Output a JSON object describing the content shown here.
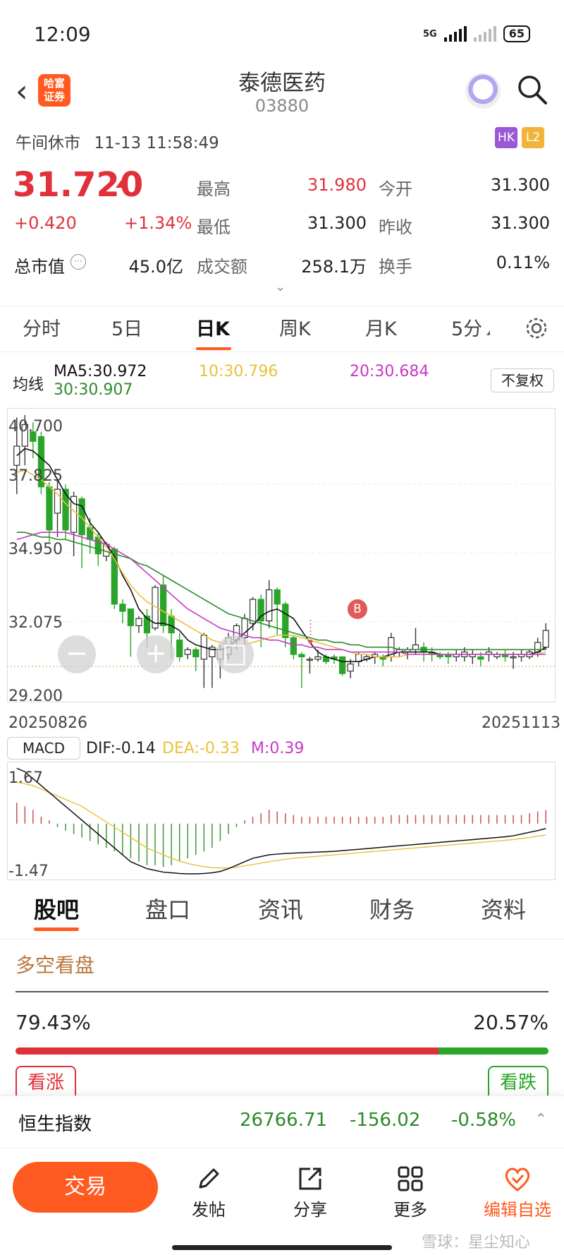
{
  "status": {
    "time": "12:09",
    "network": "5G",
    "battery": "65"
  },
  "header": {
    "logo_line1": "哈富",
    "logo_line2": "证券",
    "title": "泰德医药",
    "code": "03880"
  },
  "session": {
    "label": "午间休市",
    "datetime": "11-13 11:58:49",
    "badge_hk": "HK",
    "badge_l2": "L2"
  },
  "quote": {
    "price": "31.720",
    "change": "+0.420",
    "change_pct": "+1.34%",
    "high_label": "最高",
    "high": "31.980",
    "open_label": "今开",
    "open": "31.300",
    "low_label": "最低",
    "low": "31.300",
    "prev_close_label": "昨收",
    "prev_close": "31.300",
    "mcap_label": "总市值",
    "mcap": "45.0亿",
    "turnover_label": "成交额",
    "turnover": "258.1万",
    "rate_label": "换手",
    "rate": "0.11%"
  },
  "chart_tabs": [
    "分时",
    "5日",
    "日K",
    "周K",
    "月K",
    "5分"
  ],
  "ma": {
    "label": "均线",
    "ma5": "MA5:30.972",
    "ma10": "10:30.796",
    "ma20": "20:30.684",
    "ma30": "30:30.907",
    "adjust_button": "不复权"
  },
  "chart_data": {
    "type": "candlestick",
    "y_ticks": [
      "40.700",
      "37.825",
      "34.950",
      "32.075",
      "29.200"
    ],
    "ylim": [
      29.2,
      40.7
    ],
    "date_start": "20250826",
    "date_end": "20251113",
    "marker": "B",
    "candles": [
      [
        38.6,
        39.4,
        37.4,
        40.6
      ],
      [
        39.4,
        40.3,
        38.6,
        40.7
      ],
      [
        40.0,
        39.6,
        38.9,
        40.4
      ],
      [
        39.8,
        37.7,
        37.4,
        40.0
      ],
      [
        37.7,
        35.9,
        35.4,
        37.9
      ],
      [
        36.6,
        37.6,
        35.6,
        38.0
      ],
      [
        37.6,
        35.9,
        35.5,
        37.8
      ],
      [
        35.8,
        37.3,
        34.8,
        37.5
      ],
      [
        37.2,
        35.7,
        34.3,
        37.3
      ],
      [
        36.0,
        35.5,
        34.9,
        36.4
      ],
      [
        35.6,
        34.9,
        34.4,
        35.8
      ],
      [
        34.8,
        35.3,
        34.6,
        35.4
      ],
      [
        35.1,
        32.8,
        32.6,
        35.2
      ],
      [
        32.8,
        32.5,
        32.0,
        33.0
      ],
      [
        32.6,
        31.9,
        30.6,
        32.6
      ],
      [
        31.9,
        32.2,
        31.6,
        32.3
      ],
      [
        32.3,
        31.6,
        31.0,
        32.6
      ],
      [
        31.8,
        33.5,
        31.7,
        33.6
      ],
      [
        33.6,
        31.9,
        31.6,
        34.0
      ],
      [
        32.3,
        31.6,
        30.5,
        32.6
      ],
      [
        31.3,
        30.6,
        30.4,
        31.6
      ],
      [
        30.7,
        30.9,
        30.5,
        31.0
      ],
      [
        30.9,
        30.6,
        30.0,
        31.0
      ],
      [
        30.5,
        31.5,
        29.3,
        31.6
      ],
      [
        30.6,
        31.0,
        29.3,
        31.1
      ],
      [
        30.5,
        30.9,
        29.7,
        31.1
      ],
      [
        30.7,
        31.4,
        30.5,
        31.6
      ],
      [
        31.3,
        31.9,
        30.9,
        32.0
      ],
      [
        31.4,
        32.2,
        31.0,
        32.4
      ],
      [
        32.0,
        33.0,
        31.7,
        33.1
      ],
      [
        33.0,
        32.1,
        31.0,
        33.2
      ],
      [
        32.1,
        33.4,
        31.8,
        33.8
      ],
      [
        33.4,
        32.8,
        31.5,
        33.5
      ],
      [
        32.8,
        31.4,
        31.0,
        32.9
      ],
      [
        31.4,
        30.7,
        30.5,
        31.5
      ],
      [
        30.7,
        30.6,
        29.3,
        30.8
      ],
      [
        30.5,
        30.5,
        29.9,
        30.6
      ],
      [
        30.5,
        30.6,
        30.4,
        30.9
      ],
      [
        30.6,
        30.4,
        30.3,
        30.7
      ],
      [
        30.6,
        30.5,
        30.3,
        30.7
      ],
      [
        30.6,
        29.9,
        29.8,
        30.6
      ],
      [
        30.0,
        30.3,
        29.7,
        30.5
      ],
      [
        30.4,
        30.7,
        30.2,
        30.8
      ],
      [
        30.5,
        30.6,
        30.4,
        30.7
      ],
      [
        30.6,
        30.7,
        30.3,
        30.8
      ],
      [
        30.6,
        30.5,
        30.2,
        30.7
      ],
      [
        30.6,
        31.4,
        30.4,
        31.6
      ],
      [
        30.8,
        30.9,
        30.6,
        31.0
      ],
      [
        30.8,
        30.9,
        30.5,
        31.0
      ],
      [
        30.9,
        31.1,
        30.7,
        31.8
      ],
      [
        31.0,
        30.8,
        30.4,
        31.2
      ],
      [
        30.8,
        30.7,
        30.4,
        31.0
      ],
      [
        30.7,
        30.6,
        30.5,
        30.8
      ],
      [
        30.7,
        30.6,
        30.3,
        30.8
      ],
      [
        30.6,
        30.7,
        30.4,
        30.9
      ],
      [
        30.6,
        30.8,
        30.4,
        31.0
      ],
      [
        30.6,
        30.7,
        30.3,
        30.9
      ],
      [
        30.6,
        30.5,
        30.2,
        30.8
      ],
      [
        30.7,
        30.8,
        30.4,
        31.0
      ],
      [
        30.6,
        30.7,
        30.5,
        30.8
      ],
      [
        30.7,
        30.6,
        30.4,
        30.9
      ],
      [
        30.6,
        30.6,
        30.1,
        30.8
      ],
      [
        30.6,
        30.7,
        30.4,
        30.9
      ],
      [
        30.6,
        30.8,
        30.5,
        30.9
      ],
      [
        30.8,
        31.2,
        30.6,
        31.4
      ],
      [
        31.0,
        31.7,
        30.9,
        32.0
      ]
    ],
    "ma5": [
      39.0,
      39.3,
      39.2,
      38.9,
      38.6,
      38.0,
      37.4,
      37.0,
      36.9,
      36.2,
      35.8,
      35.3,
      34.8,
      34.0,
      33.4,
      32.6,
      32.2,
      32.0,
      32.0,
      31.9,
      31.7,
      31.3,
      31.1,
      31.0,
      30.9,
      30.9,
      31.0,
      31.3,
      31.6,
      31.9,
      32.3,
      32.5,
      32.6,
      32.4,
      32.2,
      31.7,
      31.2,
      30.8,
      30.6,
      30.5,
      30.4,
      30.4,
      30.4,
      30.5,
      30.6,
      30.6,
      30.7,
      30.8,
      30.8,
      30.8,
      30.8,
      30.8,
      30.7,
      30.7,
      30.7,
      30.7,
      30.7,
      30.7,
      30.7,
      30.7,
      30.7,
      30.7,
      30.7,
      30.7,
      30.8,
      31.0
    ],
    "ma10": [
      38.3,
      38.4,
      38.2,
      38.0,
      37.7,
      37.4,
      37.0,
      36.7,
      36.4,
      36.0,
      35.6,
      35.2,
      34.7,
      34.1,
      33.6,
      33.2,
      32.9,
      32.7,
      32.5,
      32.3,
      32.1,
      31.9,
      31.7,
      31.5,
      31.3,
      31.2,
      31.1,
      31.1,
      31.1,
      31.2,
      31.3,
      31.4,
      31.5,
      31.5,
      31.5,
      31.4,
      31.3,
      31.2,
      31.1,
      31.0,
      30.9,
      30.8,
      30.7,
      30.7,
      30.6,
      30.6,
      30.6,
      30.6,
      30.7,
      30.7,
      30.7,
      30.7,
      30.7,
      30.7,
      30.7,
      30.7,
      30.7,
      30.7,
      30.7,
      30.7,
      30.7,
      30.7,
      30.7,
      30.7,
      30.7,
      30.8
    ],
    "ma20": [
      35.5,
      35.6,
      35.7,
      35.8,
      35.8,
      35.8,
      35.8,
      35.7,
      35.6,
      35.5,
      35.4,
      35.3,
      35.1,
      34.9,
      34.7,
      34.4,
      34.1,
      33.8,
      33.5,
      33.2,
      32.9,
      32.6,
      32.4,
      32.2,
      32.0,
      31.8,
      31.7,
      31.6,
      31.5,
      31.4,
      31.4,
      31.3,
      31.3,
      31.2,
      31.1,
      31.1,
      31.0,
      31.0,
      30.9,
      30.9,
      30.9,
      30.8,
      30.8,
      30.8,
      30.8,
      30.8,
      30.8,
      30.8,
      30.7,
      30.7,
      30.7,
      30.7,
      30.7,
      30.7,
      30.7,
      30.7,
      30.7,
      30.7,
      30.7,
      30.7,
      30.7,
      30.7,
      30.7,
      30.7,
      30.7,
      30.7
    ],
    "ma30": [
      35.8,
      35.8,
      35.7,
      35.6,
      35.6,
      35.5,
      35.5,
      35.4,
      35.3,
      35.2,
      35.1,
      35.0,
      34.9,
      34.8,
      34.7,
      34.5,
      34.4,
      34.2,
      34.0,
      33.8,
      33.6,
      33.4,
      33.2,
      33.0,
      32.8,
      32.6,
      32.4,
      32.3,
      32.2,
      32.1,
      32.0,
      31.9,
      31.8,
      31.7,
      31.6,
      31.5,
      31.4,
      31.3,
      31.3,
      31.2,
      31.2,
      31.1,
      31.1,
      31.0,
      31.0,
      31.0,
      31.0,
      30.9,
      30.9,
      30.9,
      30.9,
      30.9,
      30.9,
      30.9,
      30.9,
      30.9,
      30.9,
      30.9,
      30.9,
      30.9,
      30.9,
      30.9,
      30.9,
      30.9,
      30.9,
      30.9
    ],
    "macd": {
      "label": "MACD",
      "dif": "DIF:-0.14",
      "dea": "DEA:-0.33",
      "m": "M:0.39",
      "y_ticks": [
        "1.67",
        "-1.47"
      ],
      "ylim": [
        -1.47,
        1.67
      ],
      "hist": [
        0.6,
        0.5,
        0.4,
        0.2,
        0.1,
        -0.1,
        -0.2,
        -0.3,
        -0.4,
        -0.5,
        -0.6,
        -0.7,
        -0.8,
        -0.9,
        -1.0,
        -1.1,
        -1.2,
        -1.2,
        -1.25,
        -1.2,
        -1.1,
        -1.0,
        -0.9,
        -0.8,
        -0.7,
        -0.5,
        -0.3,
        -0.1,
        0.1,
        0.2,
        0.3,
        0.4,
        0.35,
        0.3,
        0.25,
        0.2,
        0.2,
        0.2,
        0.2,
        0.2,
        0.2,
        0.2,
        0.2,
        0.2,
        0.2,
        0.2,
        0.25,
        0.25,
        0.25,
        0.25,
        0.25,
        0.25,
        0.25,
        0.25,
        0.25,
        0.25,
        0.25,
        0.25,
        0.25,
        0.25,
        0.25,
        0.25,
        0.25,
        0.3,
        0.35,
        0.39
      ],
      "dif_line": [
        1.6,
        1.5,
        1.3,
        1.1,
        0.9,
        0.7,
        0.5,
        0.3,
        0.1,
        -0.1,
        -0.3,
        -0.5,
        -0.7,
        -0.9,
        -1.1,
        -1.2,
        -1.3,
        -1.35,
        -1.4,
        -1.42,
        -1.44,
        -1.45,
        -1.45,
        -1.44,
        -1.42,
        -1.38,
        -1.3,
        -1.2,
        -1.1,
        -1.0,
        -0.95,
        -0.9,
        -0.88,
        -0.86,
        -0.85,
        -0.84,
        -0.83,
        -0.82,
        -0.81,
        -0.8,
        -0.78,
        -0.76,
        -0.74,
        -0.72,
        -0.7,
        -0.68,
        -0.66,
        -0.64,
        -0.62,
        -0.6,
        -0.58,
        -0.56,
        -0.54,
        -0.52,
        -0.5,
        -0.48,
        -0.46,
        -0.44,
        -0.42,
        -0.4,
        -0.38,
        -0.35,
        -0.3,
        -0.25,
        -0.2,
        -0.14
      ],
      "dea_line": [
        1.2,
        1.15,
        1.1,
        1.0,
        0.9,
        0.8,
        0.7,
        0.6,
        0.5,
        0.35,
        0.2,
        0.05,
        -0.1,
        -0.25,
        -0.4,
        -0.55,
        -0.7,
        -0.8,
        -0.9,
        -1.0,
        -1.08,
        -1.15,
        -1.2,
        -1.24,
        -1.27,
        -1.28,
        -1.28,
        -1.26,
        -1.22,
        -1.18,
        -1.14,
        -1.1,
        -1.06,
        -1.03,
        -1.0,
        -0.98,
        -0.96,
        -0.94,
        -0.92,
        -0.9,
        -0.88,
        -0.86,
        -0.84,
        -0.82,
        -0.8,
        -0.78,
        -0.76,
        -0.74,
        -0.72,
        -0.7,
        -0.68,
        -0.66,
        -0.64,
        -0.62,
        -0.6,
        -0.58,
        -0.56,
        -0.54,
        -0.52,
        -0.5,
        -0.48,
        -0.46,
        -0.43,
        -0.4,
        -0.36,
        -0.33
      ]
    }
  },
  "bottom_tabs": [
    "股吧",
    "盘口",
    "资讯",
    "财务",
    "资料"
  ],
  "sentiment": {
    "title": "多空看盘",
    "bull_pct": "79.43%",
    "bear_pct": "20.57%",
    "bull_frac": 0.7943,
    "bull_label": "看涨",
    "bear_label": "看跌"
  },
  "index": {
    "name": "恒生指数",
    "value": "26766.71",
    "change": "-156.02",
    "change_pct": "-0.58%"
  },
  "bottom_bar": {
    "trade": "交易",
    "post": "发帖",
    "share": "分享",
    "more": "更多",
    "edit_watch": "编辑自选"
  },
  "watermark": "雪球：星尘知心",
  "colors": {
    "up": "#e0313a",
    "down": "#2aa52a",
    "accent": "#ff5a1f",
    "ma5": "#111111",
    "ma10": "#e8c23a",
    "ma20": "#c639c6",
    "ma30": "#2e8b2e"
  }
}
